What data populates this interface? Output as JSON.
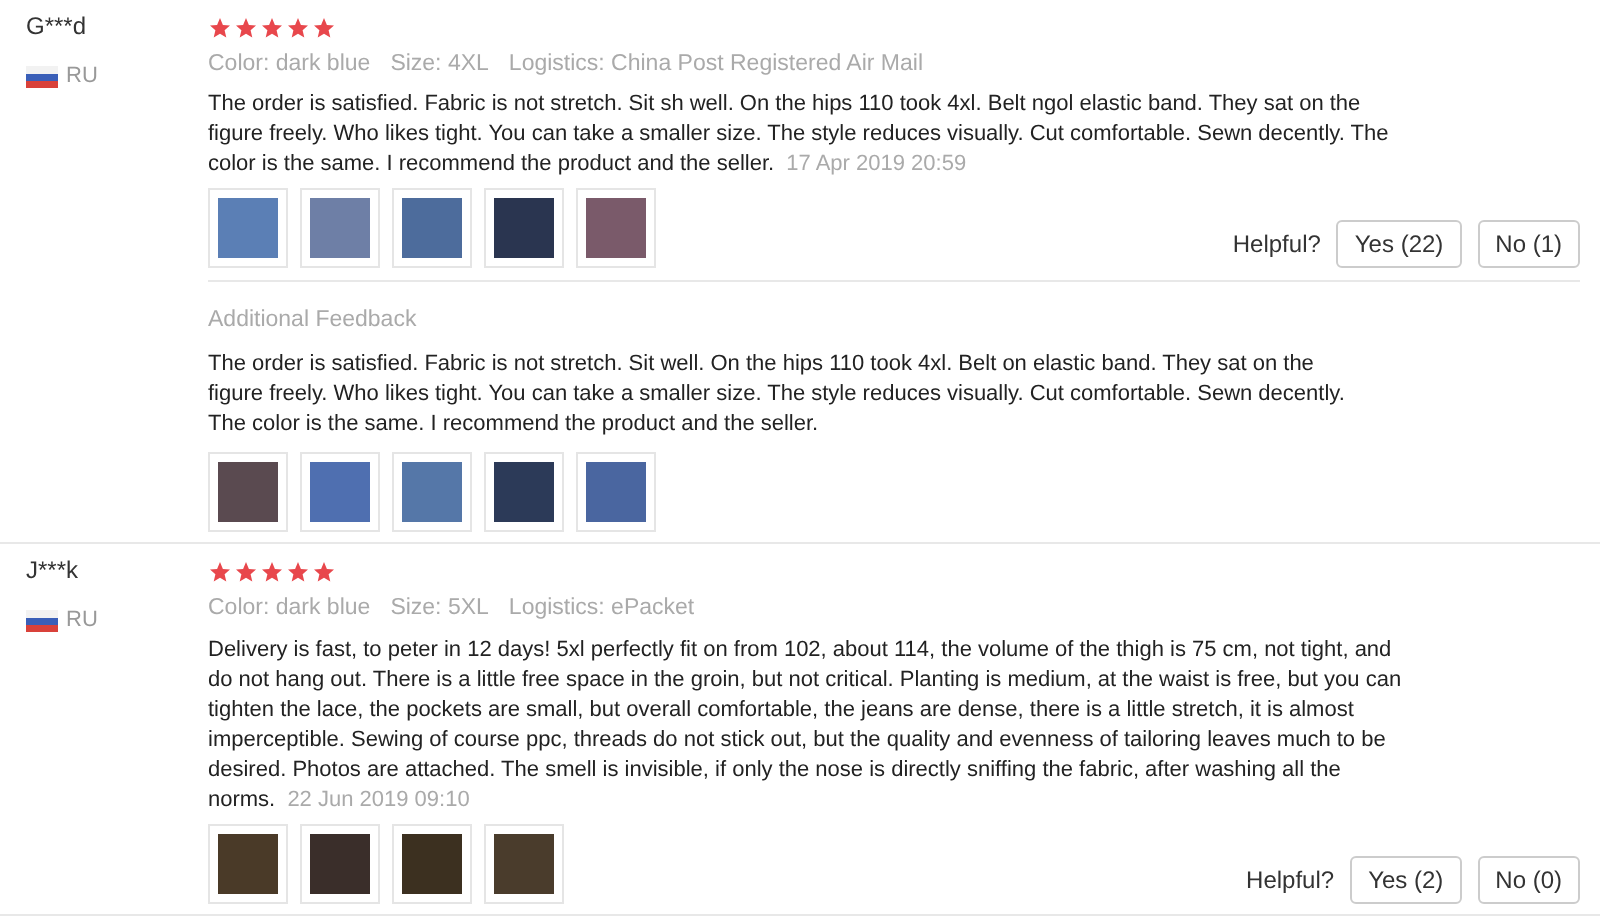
{
  "reviews": [
    {
      "user": "G***d",
      "country": "RU",
      "stars": 5,
      "meta": [
        "Color: dark blue",
        "Size: 4XL",
        "Logistics: China Post Registered Air Mail"
      ],
      "text": "The order is satisfied. Fabric is not stretch. Sit sh well. On the hips 110 took 4xl. Belt ngol elastic band. They sat on the figure freely. Who likes tight. You can take a smaller size. The style reduces visually. Cut comfortable. Sewn decently. The color is the same. I recommend the product and the seller.",
      "date": "17 Apr 2019 20:59",
      "photos": [
        {
          "color": "#5b7fb5"
        },
        {
          "color": "#6e7fa6"
        },
        {
          "color": "#4d6c9c"
        },
        {
          "color": "#2a3550"
        },
        {
          "color": "#7a5a6a"
        }
      ],
      "helpful": {
        "label": "Helpful?",
        "yes": "Yes (22)",
        "no": "No (1)"
      },
      "additional": {
        "title": "Additional Feedback",
        "text": "The order is satisfied. Fabric is not stretch. Sit well. On the hips 110 took 4xl. Belt on elastic band. They sat on the figure freely. Who likes tight. You can take a smaller size. The style reduces visually. Cut comfortable. Sewn decently. The color is the same. I recommend the product and the seller.",
        "photos": [
          {
            "color": "#5a4a50"
          },
          {
            "color": "#4f6fb0"
          },
          {
            "color": "#5577a8"
          },
          {
            "color": "#2c3a58"
          },
          {
            "color": "#4a66a0"
          }
        ]
      }
    },
    {
      "user": "J***k",
      "country": "RU",
      "stars": 5,
      "meta": [
        "Color: dark blue",
        "Size: 5XL",
        "Logistics: ePacket"
      ],
      "text": "Delivery is fast, to peter in 12 days! 5xl perfectly fit on from 102, about 114, the volume of the thigh is 75 cm, not tight, and do not hang out. There is a little free space in the groin, but not critical. Planting is medium, at the waist is free, but you can tighten the lace, the pockets are small, but overall comfortable, the jeans are dense, there is a little stretch, it is almost imperceptible. Sewing of course ppc, threads do not stick out, but the quality and evenness of tailoring leaves much to be desired. Photos are attached. The smell is invisible, if only the nose is directly sniffing the fabric, after washing all the norms.",
      "date": "22 Jun 2019 09:10",
      "photos": [
        {
          "color": "#4a3a28"
        },
        {
          "color": "#3a2e2a"
        },
        {
          "color": "#3c3020"
        },
        {
          "color": "#4a3c2c"
        }
      ],
      "helpful": {
        "label": "Helpful?",
        "yes": "Yes (2)",
        "no": "No (0)"
      }
    }
  ]
}
